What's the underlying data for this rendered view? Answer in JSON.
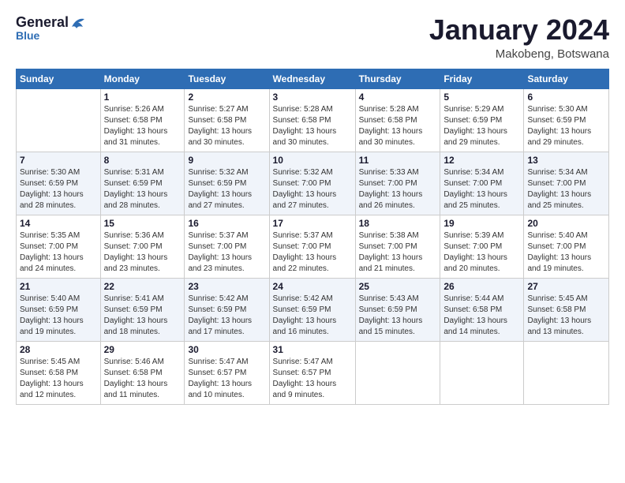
{
  "logo": {
    "general": "General",
    "blue": "Blue"
  },
  "title": "January 2024",
  "location": "Makobeng, Botswana",
  "weekdays": [
    "Sunday",
    "Monday",
    "Tuesday",
    "Wednesday",
    "Thursday",
    "Friday",
    "Saturday"
  ],
  "weeks": [
    [
      {
        "day": "",
        "info": ""
      },
      {
        "day": "1",
        "info": "Sunrise: 5:26 AM\nSunset: 6:58 PM\nDaylight: 13 hours\nand 31 minutes."
      },
      {
        "day": "2",
        "info": "Sunrise: 5:27 AM\nSunset: 6:58 PM\nDaylight: 13 hours\nand 30 minutes."
      },
      {
        "day": "3",
        "info": "Sunrise: 5:28 AM\nSunset: 6:58 PM\nDaylight: 13 hours\nand 30 minutes."
      },
      {
        "day": "4",
        "info": "Sunrise: 5:28 AM\nSunset: 6:58 PM\nDaylight: 13 hours\nand 30 minutes."
      },
      {
        "day": "5",
        "info": "Sunrise: 5:29 AM\nSunset: 6:59 PM\nDaylight: 13 hours\nand 29 minutes."
      },
      {
        "day": "6",
        "info": "Sunrise: 5:30 AM\nSunset: 6:59 PM\nDaylight: 13 hours\nand 29 minutes."
      }
    ],
    [
      {
        "day": "7",
        "info": "Sunrise: 5:30 AM\nSunset: 6:59 PM\nDaylight: 13 hours\nand 28 minutes."
      },
      {
        "day": "8",
        "info": "Sunrise: 5:31 AM\nSunset: 6:59 PM\nDaylight: 13 hours\nand 28 minutes."
      },
      {
        "day": "9",
        "info": "Sunrise: 5:32 AM\nSunset: 6:59 PM\nDaylight: 13 hours\nand 27 minutes."
      },
      {
        "day": "10",
        "info": "Sunrise: 5:32 AM\nSunset: 7:00 PM\nDaylight: 13 hours\nand 27 minutes."
      },
      {
        "day": "11",
        "info": "Sunrise: 5:33 AM\nSunset: 7:00 PM\nDaylight: 13 hours\nand 26 minutes."
      },
      {
        "day": "12",
        "info": "Sunrise: 5:34 AM\nSunset: 7:00 PM\nDaylight: 13 hours\nand 25 minutes."
      },
      {
        "day": "13",
        "info": "Sunrise: 5:34 AM\nSunset: 7:00 PM\nDaylight: 13 hours\nand 25 minutes."
      }
    ],
    [
      {
        "day": "14",
        "info": "Sunrise: 5:35 AM\nSunset: 7:00 PM\nDaylight: 13 hours\nand 24 minutes."
      },
      {
        "day": "15",
        "info": "Sunrise: 5:36 AM\nSunset: 7:00 PM\nDaylight: 13 hours\nand 23 minutes."
      },
      {
        "day": "16",
        "info": "Sunrise: 5:37 AM\nSunset: 7:00 PM\nDaylight: 13 hours\nand 23 minutes."
      },
      {
        "day": "17",
        "info": "Sunrise: 5:37 AM\nSunset: 7:00 PM\nDaylight: 13 hours\nand 22 minutes."
      },
      {
        "day": "18",
        "info": "Sunrise: 5:38 AM\nSunset: 7:00 PM\nDaylight: 13 hours\nand 21 minutes."
      },
      {
        "day": "19",
        "info": "Sunrise: 5:39 AM\nSunset: 7:00 PM\nDaylight: 13 hours\nand 20 minutes."
      },
      {
        "day": "20",
        "info": "Sunrise: 5:40 AM\nSunset: 7:00 PM\nDaylight: 13 hours\nand 19 minutes."
      }
    ],
    [
      {
        "day": "21",
        "info": "Sunrise: 5:40 AM\nSunset: 6:59 PM\nDaylight: 13 hours\nand 19 minutes."
      },
      {
        "day": "22",
        "info": "Sunrise: 5:41 AM\nSunset: 6:59 PM\nDaylight: 13 hours\nand 18 minutes."
      },
      {
        "day": "23",
        "info": "Sunrise: 5:42 AM\nSunset: 6:59 PM\nDaylight: 13 hours\nand 17 minutes."
      },
      {
        "day": "24",
        "info": "Sunrise: 5:42 AM\nSunset: 6:59 PM\nDaylight: 13 hours\nand 16 minutes."
      },
      {
        "day": "25",
        "info": "Sunrise: 5:43 AM\nSunset: 6:59 PM\nDaylight: 13 hours\nand 15 minutes."
      },
      {
        "day": "26",
        "info": "Sunrise: 5:44 AM\nSunset: 6:58 PM\nDaylight: 13 hours\nand 14 minutes."
      },
      {
        "day": "27",
        "info": "Sunrise: 5:45 AM\nSunset: 6:58 PM\nDaylight: 13 hours\nand 13 minutes."
      }
    ],
    [
      {
        "day": "28",
        "info": "Sunrise: 5:45 AM\nSunset: 6:58 PM\nDaylight: 13 hours\nand 12 minutes."
      },
      {
        "day": "29",
        "info": "Sunrise: 5:46 AM\nSunset: 6:58 PM\nDaylight: 13 hours\nand 11 minutes."
      },
      {
        "day": "30",
        "info": "Sunrise: 5:47 AM\nSunset: 6:57 PM\nDaylight: 13 hours\nand 10 minutes."
      },
      {
        "day": "31",
        "info": "Sunrise: 5:47 AM\nSunset: 6:57 PM\nDaylight: 13 hours\nand 9 minutes."
      },
      {
        "day": "",
        "info": ""
      },
      {
        "day": "",
        "info": ""
      },
      {
        "day": "",
        "info": ""
      }
    ]
  ]
}
